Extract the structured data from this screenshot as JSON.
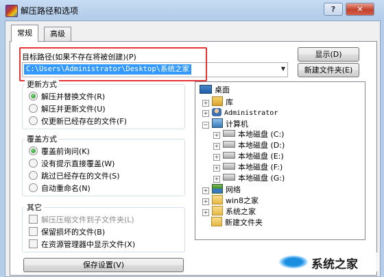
{
  "window": {
    "title": "解压路径和选项",
    "help": "?",
    "close": "✕"
  },
  "tabs": [
    {
      "label": "常规"
    },
    {
      "label": "高级"
    }
  ],
  "target": {
    "label": "目标路径(如果不存在将被创建)(P)",
    "value": "C:\\Users\\Administrator\\Desktop\\系统之家"
  },
  "buttons": {
    "show": "显示(D)",
    "new_folder": "新建文件夹(E)",
    "save": "保存设置(V)"
  },
  "update_mode": {
    "title": "更新方式",
    "options": [
      {
        "label": "解压并替换文件(R)",
        "selected": true
      },
      {
        "label": "解压并更新文件(U)",
        "selected": false
      },
      {
        "label": "仅更新已经存在的文件(F)",
        "selected": false
      }
    ]
  },
  "overwrite_mode": {
    "title": "覆盖方式",
    "options": [
      {
        "label": "覆盖前询问(K)",
        "selected": true
      },
      {
        "label": "没有提示直接覆盖(W)",
        "selected": false
      },
      {
        "label": "跳过已经存在的文件(S)",
        "selected": false
      },
      {
        "label": "自动重命名(N)",
        "selected": false
      }
    ]
  },
  "misc": {
    "title": "其它",
    "options": [
      {
        "label": "解压压缩文件到子文件夹(L)",
        "checked": false,
        "disabled": true
      },
      {
        "label": "保留损坏的文件(B)",
        "checked": false,
        "disabled": false
      },
      {
        "label": "在资源管理器中显示文件(X)",
        "checked": false,
        "disabled": false
      }
    ]
  },
  "tree": {
    "desktop": "桌面",
    "library": "库",
    "user": "Administrator",
    "computer": "计算机",
    "drives": [
      "本地磁盘 (C:)",
      "本地磁盘 (D:)",
      "本地磁盘 (E:)",
      "本地磁盘 (F:)",
      "本地磁盘 (G:)"
    ],
    "network": "网络",
    "folders": [
      "win8之家",
      "系统之家",
      "新建文件夹"
    ]
  },
  "watermark": {
    "text": "系统之家"
  }
}
